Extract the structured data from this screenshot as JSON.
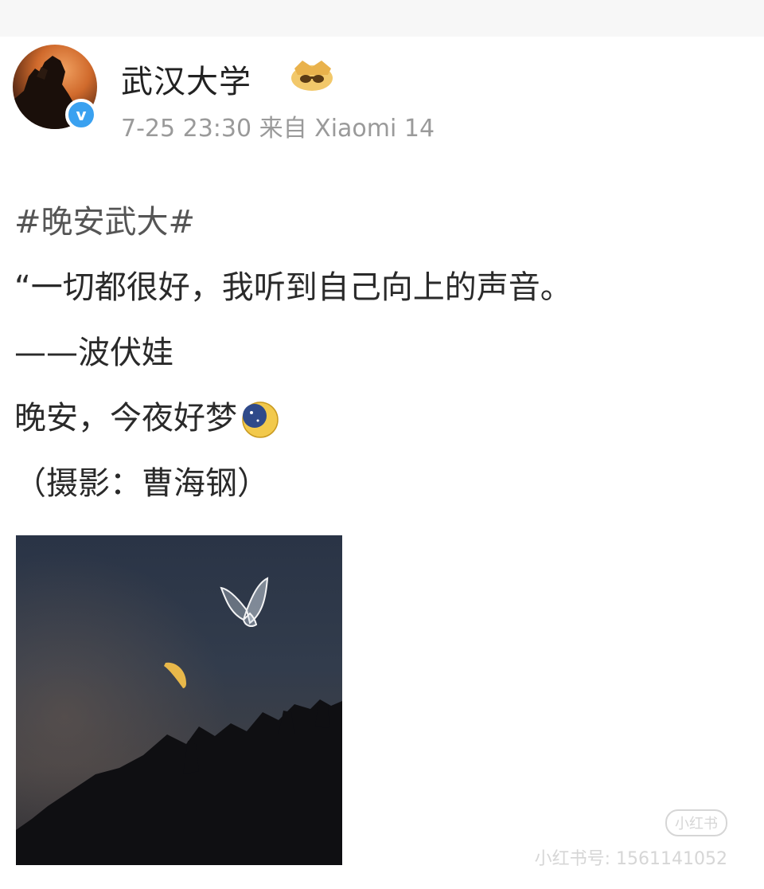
{
  "post": {
    "account_name": "武汉大学",
    "verified_mark": "v",
    "timestamp": "7-25 23:30",
    "source": "来自 Xiaomi 14",
    "hashtag": "#晚安武大#",
    "quote": "“一切都很好，我听到自己向上的声音。",
    "author": "——波伏娃",
    "goodnight": "晚安，今夜好梦",
    "photo_credit": "（摄影：曹海钢）",
    "icons": {
      "avatar": "avatar-image",
      "verified": "verified-badge-icon",
      "vip": "vip-badge-icon",
      "emoji": "moon-emoji-icon"
    }
  },
  "watermark": {
    "logo": "小红书",
    "id_text": "小红书号: 1561141052"
  },
  "colors": {
    "text": "#2a2a2a",
    "meta": "#9a9a9a",
    "verified": "#3aa1f0"
  }
}
